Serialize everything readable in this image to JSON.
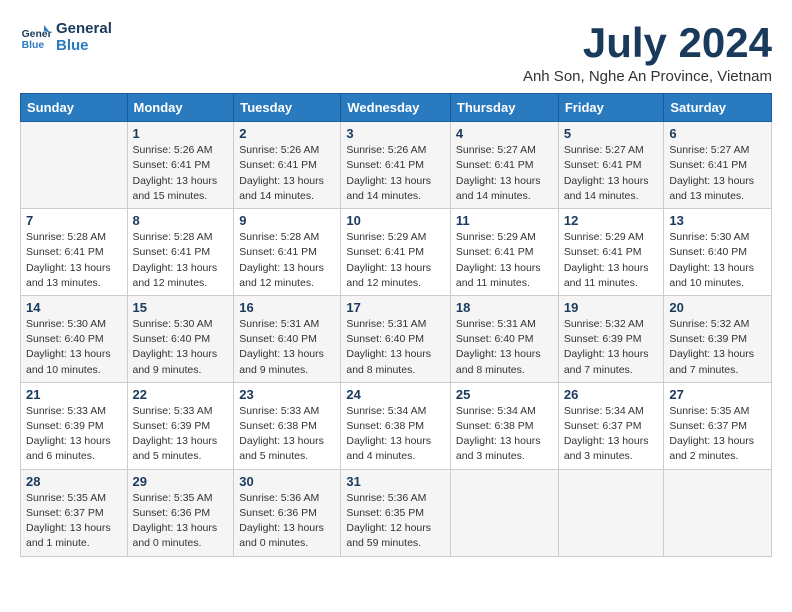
{
  "header": {
    "logo_line1": "General",
    "logo_line2": "Blue",
    "month_year": "July 2024",
    "location": "Anh Son, Nghe An Province, Vietnam"
  },
  "weekdays": [
    "Sunday",
    "Monday",
    "Tuesday",
    "Wednesday",
    "Thursday",
    "Friday",
    "Saturday"
  ],
  "weeks": [
    [
      {
        "day": "",
        "sunrise": "",
        "sunset": "",
        "daylight": ""
      },
      {
        "day": "1",
        "sunrise": "Sunrise: 5:26 AM",
        "sunset": "Sunset: 6:41 PM",
        "daylight": "Daylight: 13 hours and 15 minutes."
      },
      {
        "day": "2",
        "sunrise": "Sunrise: 5:26 AM",
        "sunset": "Sunset: 6:41 PM",
        "daylight": "Daylight: 13 hours and 14 minutes."
      },
      {
        "day": "3",
        "sunrise": "Sunrise: 5:26 AM",
        "sunset": "Sunset: 6:41 PM",
        "daylight": "Daylight: 13 hours and 14 minutes."
      },
      {
        "day": "4",
        "sunrise": "Sunrise: 5:27 AM",
        "sunset": "Sunset: 6:41 PM",
        "daylight": "Daylight: 13 hours and 14 minutes."
      },
      {
        "day": "5",
        "sunrise": "Sunrise: 5:27 AM",
        "sunset": "Sunset: 6:41 PM",
        "daylight": "Daylight: 13 hours and 14 minutes."
      },
      {
        "day": "6",
        "sunrise": "Sunrise: 5:27 AM",
        "sunset": "Sunset: 6:41 PM",
        "daylight": "Daylight: 13 hours and 13 minutes."
      }
    ],
    [
      {
        "day": "7",
        "sunrise": "Sunrise: 5:28 AM",
        "sunset": "Sunset: 6:41 PM",
        "daylight": "Daylight: 13 hours and 13 minutes."
      },
      {
        "day": "8",
        "sunrise": "Sunrise: 5:28 AM",
        "sunset": "Sunset: 6:41 PM",
        "daylight": "Daylight: 13 hours and 12 minutes."
      },
      {
        "day": "9",
        "sunrise": "Sunrise: 5:28 AM",
        "sunset": "Sunset: 6:41 PM",
        "daylight": "Daylight: 13 hours and 12 minutes."
      },
      {
        "day": "10",
        "sunrise": "Sunrise: 5:29 AM",
        "sunset": "Sunset: 6:41 PM",
        "daylight": "Daylight: 13 hours and 12 minutes."
      },
      {
        "day": "11",
        "sunrise": "Sunrise: 5:29 AM",
        "sunset": "Sunset: 6:41 PM",
        "daylight": "Daylight: 13 hours and 11 minutes."
      },
      {
        "day": "12",
        "sunrise": "Sunrise: 5:29 AM",
        "sunset": "Sunset: 6:41 PM",
        "daylight": "Daylight: 13 hours and 11 minutes."
      },
      {
        "day": "13",
        "sunrise": "Sunrise: 5:30 AM",
        "sunset": "Sunset: 6:40 PM",
        "daylight": "Daylight: 13 hours and 10 minutes."
      }
    ],
    [
      {
        "day": "14",
        "sunrise": "Sunrise: 5:30 AM",
        "sunset": "Sunset: 6:40 PM",
        "daylight": "Daylight: 13 hours and 10 minutes."
      },
      {
        "day": "15",
        "sunrise": "Sunrise: 5:30 AM",
        "sunset": "Sunset: 6:40 PM",
        "daylight": "Daylight: 13 hours and 9 minutes."
      },
      {
        "day": "16",
        "sunrise": "Sunrise: 5:31 AM",
        "sunset": "Sunset: 6:40 PM",
        "daylight": "Daylight: 13 hours and 9 minutes."
      },
      {
        "day": "17",
        "sunrise": "Sunrise: 5:31 AM",
        "sunset": "Sunset: 6:40 PM",
        "daylight": "Daylight: 13 hours and 8 minutes."
      },
      {
        "day": "18",
        "sunrise": "Sunrise: 5:31 AM",
        "sunset": "Sunset: 6:40 PM",
        "daylight": "Daylight: 13 hours and 8 minutes."
      },
      {
        "day": "19",
        "sunrise": "Sunrise: 5:32 AM",
        "sunset": "Sunset: 6:39 PM",
        "daylight": "Daylight: 13 hours and 7 minutes."
      },
      {
        "day": "20",
        "sunrise": "Sunrise: 5:32 AM",
        "sunset": "Sunset: 6:39 PM",
        "daylight": "Daylight: 13 hours and 7 minutes."
      }
    ],
    [
      {
        "day": "21",
        "sunrise": "Sunrise: 5:33 AM",
        "sunset": "Sunset: 6:39 PM",
        "daylight": "Daylight: 13 hours and 6 minutes."
      },
      {
        "day": "22",
        "sunrise": "Sunrise: 5:33 AM",
        "sunset": "Sunset: 6:39 PM",
        "daylight": "Daylight: 13 hours and 5 minutes."
      },
      {
        "day": "23",
        "sunrise": "Sunrise: 5:33 AM",
        "sunset": "Sunset: 6:38 PM",
        "daylight": "Daylight: 13 hours and 5 minutes."
      },
      {
        "day": "24",
        "sunrise": "Sunrise: 5:34 AM",
        "sunset": "Sunset: 6:38 PM",
        "daylight": "Daylight: 13 hours and 4 minutes."
      },
      {
        "day": "25",
        "sunrise": "Sunrise: 5:34 AM",
        "sunset": "Sunset: 6:38 PM",
        "daylight": "Daylight: 13 hours and 3 minutes."
      },
      {
        "day": "26",
        "sunrise": "Sunrise: 5:34 AM",
        "sunset": "Sunset: 6:37 PM",
        "daylight": "Daylight: 13 hours and 3 minutes."
      },
      {
        "day": "27",
        "sunrise": "Sunrise: 5:35 AM",
        "sunset": "Sunset: 6:37 PM",
        "daylight": "Daylight: 13 hours and 2 minutes."
      }
    ],
    [
      {
        "day": "28",
        "sunrise": "Sunrise: 5:35 AM",
        "sunset": "Sunset: 6:37 PM",
        "daylight": "Daylight: 13 hours and 1 minute."
      },
      {
        "day": "29",
        "sunrise": "Sunrise: 5:35 AM",
        "sunset": "Sunset: 6:36 PM",
        "daylight": "Daylight: 13 hours and 0 minutes."
      },
      {
        "day": "30",
        "sunrise": "Sunrise: 5:36 AM",
        "sunset": "Sunset: 6:36 PM",
        "daylight": "Daylight: 13 hours and 0 minutes."
      },
      {
        "day": "31",
        "sunrise": "Sunrise: 5:36 AM",
        "sunset": "Sunset: 6:35 PM",
        "daylight": "Daylight: 12 hours and 59 minutes."
      },
      {
        "day": "",
        "sunrise": "",
        "sunset": "",
        "daylight": ""
      },
      {
        "day": "",
        "sunrise": "",
        "sunset": "",
        "daylight": ""
      },
      {
        "day": "",
        "sunrise": "",
        "sunset": "",
        "daylight": ""
      }
    ]
  ]
}
